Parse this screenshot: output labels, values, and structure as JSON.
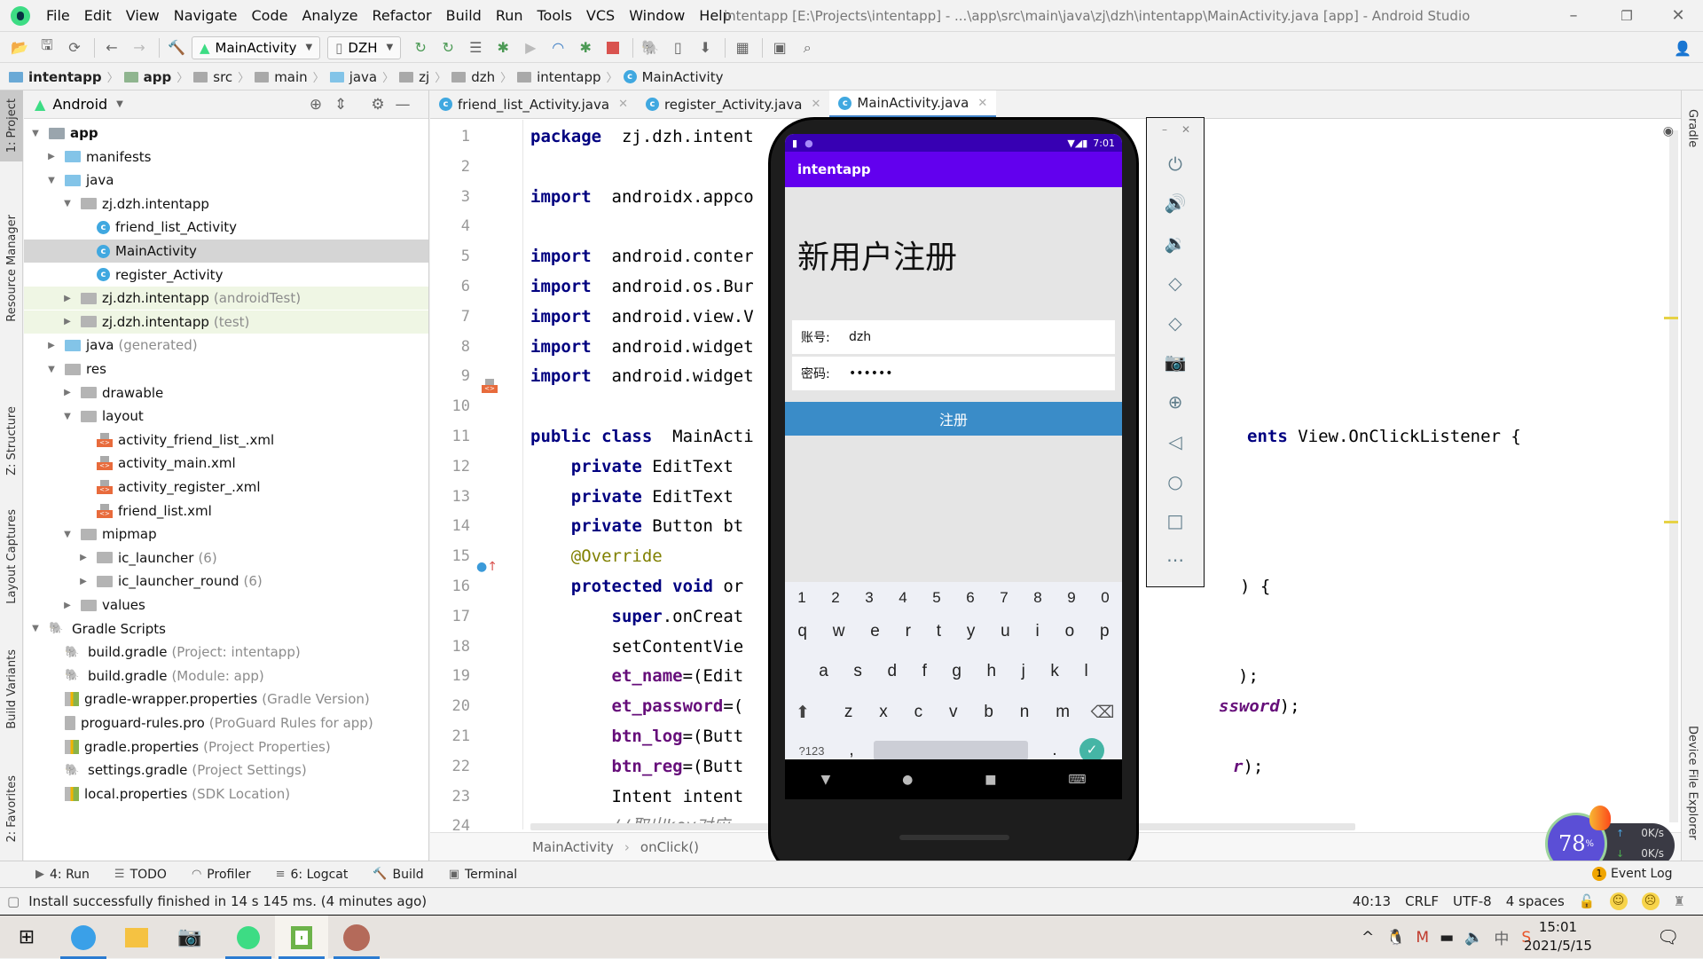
{
  "menubar": {
    "items": [
      "File",
      "Edit",
      "View",
      "Navigate",
      "Code",
      "Analyze",
      "Refactor",
      "Build",
      "Run",
      "Tools",
      "VCS",
      "Window",
      "Help"
    ],
    "window_title": "intentapp [E:\\Projects\\intentapp] - ...\\app\\src\\main\\java\\zj\\dzh\\intentapp\\MainActivity.java [app] - Android Studio"
  },
  "toolbar": {
    "run_config": "MainActivity",
    "device": "DZH"
  },
  "breadcrumb": [
    "intentapp",
    "app",
    "src",
    "main",
    "java",
    "zj",
    "dzh",
    "intentapp",
    "MainActivity"
  ],
  "left_strip": [
    "1: Project",
    "Resource Manager",
    "Z: Structure",
    "Layout Captures",
    "Build Variants",
    "2: Favorites"
  ],
  "project_panel": {
    "view_mode": "Android",
    "tree": [
      {
        "label": "app",
        "hint": "",
        "depth": 0,
        "expanded": true,
        "icon": "module"
      },
      {
        "label": "manifests",
        "hint": "",
        "depth": 1,
        "expanded": false,
        "icon": "folder-blue"
      },
      {
        "label": "java",
        "hint": "",
        "depth": 1,
        "expanded": true,
        "icon": "folder-blue"
      },
      {
        "label": "zj.dzh.intentapp",
        "hint": "",
        "depth": 2,
        "expanded": true,
        "icon": "package"
      },
      {
        "label": "friend_list_Activity",
        "hint": "",
        "depth": 3,
        "icon": "class"
      },
      {
        "label": "MainActivity",
        "hint": "",
        "depth": 3,
        "icon": "class",
        "selected": true
      },
      {
        "label": "register_Activity",
        "hint": "",
        "depth": 3,
        "icon": "class"
      },
      {
        "label": "zj.dzh.intentapp",
        "hint": "(androidTest)",
        "depth": 2,
        "expanded": false,
        "icon": "package",
        "test": true
      },
      {
        "label": "zj.dzh.intentapp",
        "hint": "(test)",
        "depth": 2,
        "expanded": false,
        "icon": "package",
        "test": true
      },
      {
        "label": "java",
        "hint": "(generated)",
        "depth": 1,
        "expanded": false,
        "icon": "folder-blue"
      },
      {
        "label": "res",
        "hint": "",
        "depth": 1,
        "expanded": true,
        "icon": "folder"
      },
      {
        "label": "drawable",
        "hint": "",
        "depth": 2,
        "expanded": false,
        "icon": "package"
      },
      {
        "label": "layout",
        "hint": "",
        "depth": 2,
        "expanded": true,
        "icon": "package"
      },
      {
        "label": "activity_friend_list_.xml",
        "hint": "",
        "depth": 3,
        "icon": "xml"
      },
      {
        "label": "activity_main.xml",
        "hint": "",
        "depth": 3,
        "icon": "xml"
      },
      {
        "label": "activity_register_.xml",
        "hint": "",
        "depth": 3,
        "icon": "xml"
      },
      {
        "label": "friend_list.xml",
        "hint": "",
        "depth": 3,
        "icon": "xml"
      },
      {
        "label": "mipmap",
        "hint": "",
        "depth": 2,
        "expanded": true,
        "icon": "package"
      },
      {
        "label": "ic_launcher",
        "hint": "(6)",
        "depth": 3,
        "expanded": false,
        "icon": "package"
      },
      {
        "label": "ic_launcher_round",
        "hint": "(6)",
        "depth": 3,
        "expanded": false,
        "icon": "package"
      },
      {
        "label": "values",
        "hint": "",
        "depth": 2,
        "expanded": false,
        "icon": "package"
      },
      {
        "label": "Gradle Scripts",
        "hint": "",
        "depth": 0,
        "expanded": true,
        "icon": "gradle"
      },
      {
        "label": "build.gradle",
        "hint": "(Project: intentapp)",
        "depth": 1,
        "icon": "gradle"
      },
      {
        "label": "build.gradle",
        "hint": "(Module: app)",
        "depth": 1,
        "icon": "gradle"
      },
      {
        "label": "gradle-wrapper.properties",
        "hint": "(Gradle Version)",
        "depth": 1,
        "icon": "props"
      },
      {
        "label": "proguard-rules.pro",
        "hint": "(ProGuard Rules for app)",
        "depth": 1,
        "icon": "file"
      },
      {
        "label": "gradle.properties",
        "hint": "(Project Properties)",
        "depth": 1,
        "icon": "props"
      },
      {
        "label": "settings.gradle",
        "hint": "(Project Settings)",
        "depth": 1,
        "icon": "gradle"
      },
      {
        "label": "local.properties",
        "hint": "(SDK Location)",
        "depth": 1,
        "icon": "props"
      }
    ]
  },
  "editor": {
    "tabs": [
      {
        "label": "friend_list_Activity.java",
        "active": false
      },
      {
        "label": "register_Activity.java",
        "active": false
      },
      {
        "label": "MainActivity.java",
        "active": true
      }
    ],
    "lines": [
      {
        "n": "1",
        "segments": [
          [
            "kw",
            "package"
          ],
          [
            "",
            "  zj.dzh.intent"
          ]
        ]
      },
      {
        "n": "2",
        "segments": []
      },
      {
        "n": "3",
        "segments": [
          [
            "kw",
            "import"
          ],
          [
            "",
            "  androidx.appco"
          ]
        ]
      },
      {
        "n": "4",
        "segments": []
      },
      {
        "n": "5",
        "segments": [
          [
            "kw",
            "import"
          ],
          [
            "",
            "  android.conter"
          ]
        ]
      },
      {
        "n": "6",
        "segments": [
          [
            "kw",
            "import"
          ],
          [
            "",
            "  android.os.Bur"
          ]
        ]
      },
      {
        "n": "7",
        "segments": [
          [
            "kw",
            "import"
          ],
          [
            "",
            "  android.view.V"
          ]
        ]
      },
      {
        "n": "8",
        "segments": [
          [
            "kw",
            "import"
          ],
          [
            "",
            "  android.widget"
          ]
        ]
      },
      {
        "n": "9",
        "segments": [
          [
            "kw",
            "import"
          ],
          [
            "",
            "  android.widget"
          ]
        ]
      },
      {
        "n": "10",
        "segments": []
      },
      {
        "n": "11",
        "segments": [
          [
            "kw",
            "public class"
          ],
          [
            "",
            "  MainActi"
          ]
        ]
      },
      {
        "n": "12",
        "segments": [
          [
            "",
            "    "
          ],
          [
            "kw",
            "private"
          ],
          [
            "",
            " EditText"
          ]
        ]
      },
      {
        "n": "13",
        "segments": [
          [
            "",
            "    "
          ],
          [
            "kw",
            "private"
          ],
          [
            "",
            " EditText"
          ]
        ]
      },
      {
        "n": "14",
        "segments": [
          [
            "",
            "    "
          ],
          [
            "kw",
            "private"
          ],
          [
            "",
            " Button bt"
          ]
        ]
      },
      {
        "n": "15",
        "segments": [
          [
            "",
            "    "
          ],
          [
            "ann",
            "@Override"
          ]
        ]
      },
      {
        "n": "16",
        "segments": [
          [
            "",
            "    "
          ],
          [
            "kw",
            "protected void"
          ],
          [
            "",
            " or"
          ]
        ]
      },
      {
        "n": "17",
        "segments": [
          [
            "",
            "        "
          ],
          [
            "kw",
            "super"
          ],
          [
            "",
            ".onCreat"
          ]
        ]
      },
      {
        "n": "18",
        "segments": [
          [
            "",
            "        setContentVie"
          ]
        ]
      },
      {
        "n": "19",
        "segments": [
          [
            "",
            "        "
          ],
          [
            "fld",
            "et_name"
          ],
          [
            "",
            "=(Edit"
          ]
        ]
      },
      {
        "n": "20",
        "segments": [
          [
            "",
            "        "
          ],
          [
            "fld",
            "et_password"
          ],
          [
            "",
            "=("
          ]
        ]
      },
      {
        "n": "21",
        "segments": [
          [
            "",
            "        "
          ],
          [
            "fld",
            "btn_log"
          ],
          [
            "",
            "=(Butt"
          ]
        ]
      },
      {
        "n": "22",
        "segments": [
          [
            "",
            "        "
          ],
          [
            "fld",
            "btn_reg"
          ],
          [
            "",
            "=(Butt"
          ]
        ]
      },
      {
        "n": "23",
        "segments": [
          [
            "",
            "        Intent intent"
          ]
        ]
      },
      {
        "n": "24",
        "segments": [
          [
            "",
            "        "
          ],
          [
            "cmt",
            "//取出key对应"
          ]
        ]
      }
    ],
    "right_fragments": {
      "line11": "ents View.OnClickListener {",
      "line16": ") {",
      "line19": ");",
      "line20": "ssword);",
      "line22": "r);"
    },
    "breadcrumb": [
      "MainActivity",
      "onClick()"
    ]
  },
  "emulator": {
    "status_time": "7:01",
    "app_title": "intentapp",
    "heading": "新用户注册",
    "account_label": "账号:",
    "account_value": "dzh",
    "password_label": "密码:",
    "password_value": "••••••",
    "register_button": "注册",
    "keyboard": {
      "numbers": [
        "1",
        "2",
        "3",
        "4",
        "5",
        "6",
        "7",
        "8",
        "9",
        "0"
      ],
      "row1": [
        "q",
        "w",
        "e",
        "r",
        "t",
        "y",
        "u",
        "i",
        "o",
        "p"
      ],
      "row2": [
        "a",
        "s",
        "d",
        "f",
        "g",
        "h",
        "j",
        "k",
        "l"
      ],
      "row3": [
        "z",
        "x",
        "c",
        "v",
        "b",
        "n",
        "m"
      ],
      "sym_key": "?123",
      "comma": ",",
      "period": "."
    },
    "side_controls": [
      "power",
      "volume-up",
      "volume-down",
      "rotate-left",
      "rotate-right",
      "screenshot",
      "zoom",
      "back",
      "home",
      "overview",
      "more"
    ]
  },
  "right_strip": [
    "Gradle",
    "Device File Explorer"
  ],
  "bottom_tools": [
    "4: Run",
    "TODO",
    "Profiler",
    "6: Logcat",
    "Build",
    "Terminal"
  ],
  "statusbar": {
    "message": "Install successfully finished in 14 s 145 ms. (4 minutes ago)",
    "position": "40:13",
    "line_sep": "CRLF",
    "encoding": "UTF-8",
    "indent": "4 spaces",
    "event_log": "Event Log",
    "event_count": "1"
  },
  "net_widget": {
    "percent": "78",
    "up": "0K/s",
    "down": "0K/s"
  },
  "taskbar": {
    "time": "15:01",
    "date": "2021/5/15",
    "ime": "中"
  }
}
